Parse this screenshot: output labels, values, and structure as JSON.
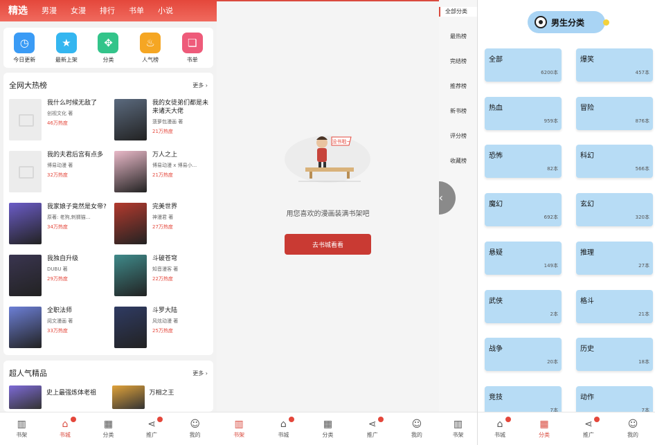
{
  "home": {
    "tabs": [
      "精选",
      "男漫",
      "女漫",
      "排行",
      "书单",
      "小说"
    ],
    "shortcuts": [
      {
        "label": "今日更新",
        "icon": "clock-icon",
        "color": "#3a9bf5"
      },
      {
        "label": "最新上架",
        "icon": "star-icon",
        "color": "#34b6f0"
      },
      {
        "label": "分类",
        "icon": "grid-icon",
        "color": "#33c48a"
      },
      {
        "label": "人气榜",
        "icon": "flame-icon",
        "color": "#f5a623"
      },
      {
        "label": "书单",
        "icon": "bookmark-icon",
        "color": "#ee5b7a"
      }
    ],
    "hot": {
      "title": "全网大热榜",
      "more": "更多",
      "books": [
        {
          "title": "我什么时候无敌了",
          "author": "创视文化 著",
          "heat": "46万热度",
          "cover": "placeholder"
        },
        {
          "title": "我的女徒弟们都是未来诸天大佬",
          "author": "菠萝包漫画 著",
          "heat": "21万热度",
          "cover": "#5b6a7e"
        },
        {
          "title": "我的夫君后宫有点多",
          "author": "博易动漫 著",
          "heat": "32万热度",
          "cover": "placeholder"
        },
        {
          "title": "万人之上",
          "author": "博易动漫 x 博易小...",
          "heat": "21万热度",
          "cover": "#e9b9c8"
        },
        {
          "title": "我家娘子竟然是女帝?",
          "author": "原著: 老狗,刺猬猫...",
          "heat": "34万热度",
          "cover": "#6b5cc7"
        },
        {
          "title": "完美世界",
          "author": "神漫君 著",
          "heat": "27万热度",
          "cover": "#b33a2e"
        },
        {
          "title": "我独自升级",
          "author": "DUBU 著",
          "heat": "29万热度",
          "cover": "#3a3550"
        },
        {
          "title": "斗破苍穹",
          "author": "知音漫客 著",
          "heat": "22万热度",
          "cover": "#3f8a8a"
        },
        {
          "title": "全职法师",
          "author": "阅文漫画 著",
          "heat": "33万热度",
          "cover": "#6c7fd6"
        },
        {
          "title": "斗罗大陆",
          "author": "风炫动漫 著",
          "heat": "25万热度",
          "cover": "#2f3b63"
        }
      ]
    },
    "popular": {
      "title": "超人气精品",
      "more": "更多",
      "books": [
        {
          "title": "史上最强炼体老祖",
          "cover": "#7d6ad6"
        },
        {
          "title": "万相之王",
          "cover": "#e0a23a"
        }
      ]
    },
    "nav": [
      {
        "label": "书架",
        "icon": "bookshelf-icon",
        "dot": false,
        "active": false
      },
      {
        "label": "书城",
        "icon": "home-icon",
        "dot": true,
        "active": true
      },
      {
        "label": "分类",
        "icon": "category-icon",
        "dot": false,
        "active": false
      },
      {
        "label": "推广",
        "icon": "share-icon",
        "dot": true,
        "active": false
      },
      {
        "label": "我的",
        "icon": "user-icon",
        "dot": false,
        "active": false
      }
    ]
  },
  "shelf": {
    "bubble": "没书啦~",
    "empty_text": "用您喜欢的漫画装满书架吧",
    "button": "去书城看看",
    "nav": [
      {
        "label": "书架",
        "icon": "bookshelf-icon",
        "dot": false,
        "active": true
      },
      {
        "label": "书城",
        "icon": "home-icon",
        "dot": true,
        "active": false
      },
      {
        "label": "分类",
        "icon": "category-icon",
        "dot": false,
        "active": false
      },
      {
        "label": "推广",
        "icon": "share-icon",
        "dot": true,
        "active": false
      },
      {
        "label": "我的",
        "icon": "user-icon",
        "dot": false,
        "active": false
      }
    ]
  },
  "ranks": {
    "items": [
      "全部分类",
      "最热榜",
      "完结榜",
      "推荐榜",
      "新书榜",
      "评分榜",
      "收藏榜"
    ],
    "nav_label": "书架"
  },
  "category": {
    "title": "男生分类",
    "items": [
      {
        "name": "全部",
        "count": "6200本"
      },
      {
        "name": "爆笑",
        "count": "457本"
      },
      {
        "name": "热血",
        "count": "959本"
      },
      {
        "name": "冒险",
        "count": "876本"
      },
      {
        "name": "恐怖",
        "count": "82本"
      },
      {
        "name": "科幻",
        "count": "566本"
      },
      {
        "name": "魔幻",
        "count": "692本"
      },
      {
        "name": "玄幻",
        "count": "320本"
      },
      {
        "name": "悬疑",
        "count": "149本"
      },
      {
        "name": "推理",
        "count": "27本"
      },
      {
        "name": "武侠",
        "count": "2本"
      },
      {
        "name": "格斗",
        "count": "21本"
      },
      {
        "name": "战争",
        "count": "20本"
      },
      {
        "name": "历史",
        "count": "18本"
      },
      {
        "name": "竞技",
        "count": "7本"
      },
      {
        "name": "动作",
        "count": "7本"
      }
    ],
    "nav": [
      {
        "label": "书城",
        "icon": "home-icon",
        "dot": true,
        "active": false
      },
      {
        "label": "分类",
        "icon": "category-icon",
        "dot": false,
        "active": true
      },
      {
        "label": "推广",
        "icon": "share-icon",
        "dot": true,
        "active": false
      },
      {
        "label": "我的",
        "icon": "user-icon",
        "dot": false,
        "active": false
      }
    ]
  }
}
